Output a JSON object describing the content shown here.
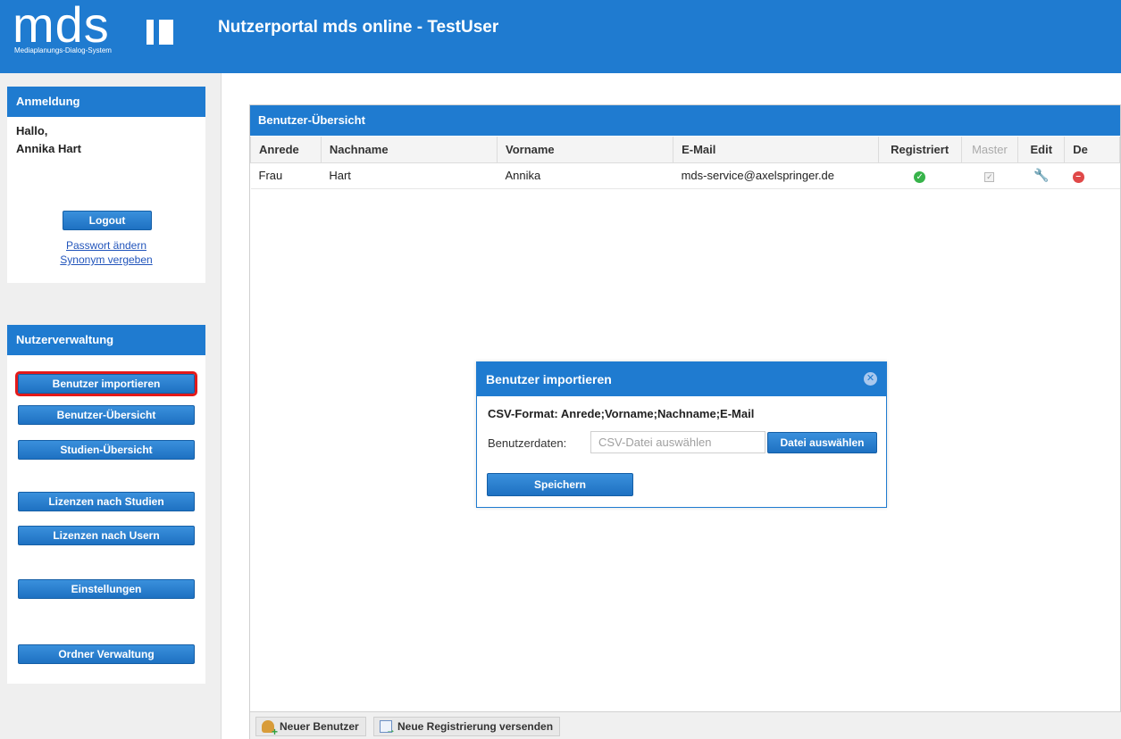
{
  "header": {
    "logo_text": "mds",
    "logo_subtitle": "Mediaplanungs-Dialog-System",
    "title": "Nutzerportal mds online - TestUser"
  },
  "login_panel": {
    "title": "Anmeldung",
    "greeting": "Hallo,",
    "user_name": "Annika Hart",
    "logout_label": "Logout",
    "change_password_label": "Passwort ändern",
    "assign_synonym_label": "Synonym vergeben"
  },
  "admin_panel": {
    "title": "Nutzerverwaltung",
    "buttons": [
      "Benutzer importieren",
      "Benutzer-Übersicht",
      "Studien-Übersicht",
      "Lizenzen nach Studien",
      "Lizenzen nach Usern",
      "Einstellungen",
      "Ordner Verwaltung"
    ],
    "active_button": "Benutzer importieren"
  },
  "main": {
    "title": "Benutzer-Übersicht",
    "columns": [
      "Anrede",
      "Nachname",
      "Vorname",
      "E-Mail",
      "Registriert",
      "Master",
      "Edit",
      "De"
    ],
    "rows": [
      {
        "anrede": "Frau",
        "nachname": "Hart",
        "vorname": "Annika",
        "email": "mds-service@axelspringer.de",
        "registriert": true,
        "master": true
      }
    ],
    "footer": {
      "new_user_label": "Neuer Benutzer",
      "send_registration_label": "Neue Registrierung versenden"
    }
  },
  "dialog": {
    "title": "Benutzer importieren",
    "csv_format": "CSV-Format: Anrede;Vorname;Nachname;E-Mail",
    "data_label": "Benutzerdaten:",
    "file_placeholder": "CSV-Datei auswählen",
    "file_button_label": "Datei auswählen",
    "save_label": "Speichern"
  },
  "icons": {
    "registered": "check-circle-icon",
    "master": "checkbox-icon",
    "edit": "wrench-icon",
    "delete": "minus-circle-icon",
    "close": "close-circle-icon"
  },
  "colors": {
    "brand_blue": "#1f7bd0",
    "active_outline": "#e31a1a",
    "success_green": "#37b34a",
    "delete_red": "#e04848"
  }
}
